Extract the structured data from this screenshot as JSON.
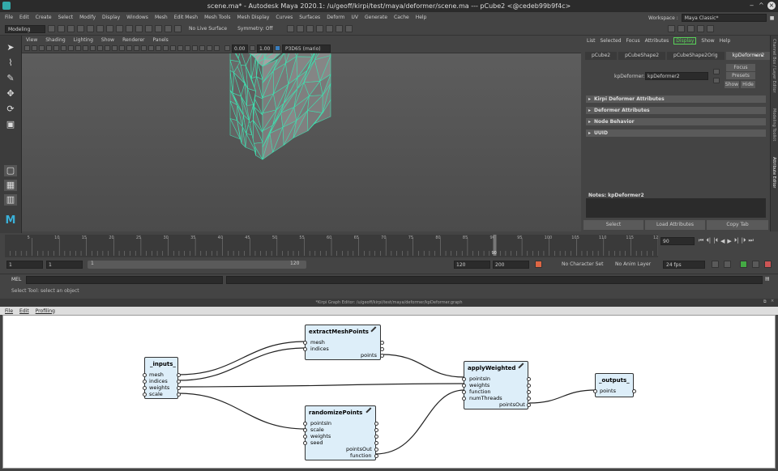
{
  "window": {
    "title": "scene.ma* - Autodesk Maya 2020.1: /u/geoff/kirpi/test/maya/deformer/scene.ma --- pCube2 <@cedeb99b9f4c>"
  },
  "menubar": {
    "items": [
      "File",
      "Edit",
      "Create",
      "Select",
      "Modify",
      "Display",
      "Windows",
      "Mesh",
      "Edit Mesh",
      "Mesh Tools",
      "Mesh Display",
      "Curves",
      "Surfaces",
      "Deform",
      "UV",
      "Generate",
      "Cache",
      "Help"
    ],
    "workspace_label": "Workspace :",
    "workspace_value": "Maya Classic*"
  },
  "status": {
    "mode": "Modeling",
    "live_surface": "No Live Surface",
    "symmetry": "Symmetry: Off"
  },
  "viewport": {
    "menu": [
      "View",
      "Shading",
      "Lighting",
      "Show",
      "Renderer",
      "Panels"
    ],
    "exposure": "0.00",
    "gamma": "1.00",
    "colorspace": "P3D65 (mario)"
  },
  "attribute_editor": {
    "menu": [
      "List",
      "Selected",
      "Focus",
      "Attributes",
      "Display",
      "Show",
      "Help"
    ],
    "tabs": [
      "pCube2",
      "pCubeShape2",
      "pCubeShape2Orig",
      "kpDeformer2"
    ],
    "node_label": "kpDeformer:",
    "node_value": "kpDeformer2",
    "focus_btn": "Focus",
    "presets_btn": "Presets",
    "show_btn": "Show",
    "hide_btn": "Hide",
    "sections": [
      "Kirpi Deformer Attributes",
      "Deformer Attributes",
      "Node Behavior",
      "UUID"
    ],
    "notes_label": "Notes:  kpDeformer2",
    "select_btn": "Select",
    "load_btn": "Load Attributes",
    "copy_btn": "Copy Tab"
  },
  "sidebar_tabs": [
    "Channel Box / Layer Editor",
    "Modeling Toolkit",
    "Attribute Editor"
  ],
  "timeline": {
    "ticks": [
      "5",
      "10",
      "15",
      "20",
      "25",
      "30",
      "35",
      "40",
      "45",
      "50",
      "55",
      "60",
      "65",
      "70",
      "75",
      "80",
      "85",
      "90",
      "95",
      "100",
      "105",
      "110",
      "115",
      "12"
    ],
    "current_frame": "90",
    "current_field": "90",
    "range_start": "1",
    "range_start2": "1",
    "range_slider_start": "1",
    "range_slider_end": "120",
    "range_end": "120",
    "anim_end": "200",
    "character_set": "No Character Set",
    "anim_layer": "No Anim Layer",
    "fps": "24 fps"
  },
  "cmdline": {
    "label": "MEL"
  },
  "helpline": {
    "text": "Select Tool: select an object"
  },
  "graph_editor": {
    "title": "*Kirpi Graph Editor: /u/geoff/kirpi/test/maya/deformer/kpDeformer.graph",
    "menu": [
      "File",
      "Edit",
      "Profiling"
    ],
    "nodes": {
      "inputs": {
        "title": "_inputs_",
        "plugs": [
          "mesh",
          "indices",
          "weights",
          "scale"
        ]
      },
      "extract": {
        "title": "extractMeshPoints",
        "in": [
          "mesh",
          "indices"
        ],
        "out": [
          "points"
        ]
      },
      "randomize": {
        "title": "randomizePoints",
        "in": [
          "pointsIn",
          "scale",
          "weights",
          "seed"
        ],
        "out": [
          "pointsOut",
          "function"
        ]
      },
      "apply": {
        "title": "applyWeighted",
        "in": [
          "pointsIn",
          "weights",
          "function",
          "numThreads"
        ],
        "out": [
          "pointsOut"
        ]
      },
      "outputs": {
        "title": "_outputs_",
        "plugs": [
          "points"
        ]
      }
    }
  },
  "colors": {
    "wire": "#3fe0b0",
    "node_bg": "#ddeef9",
    "accent_green": "#5ad35a"
  }
}
